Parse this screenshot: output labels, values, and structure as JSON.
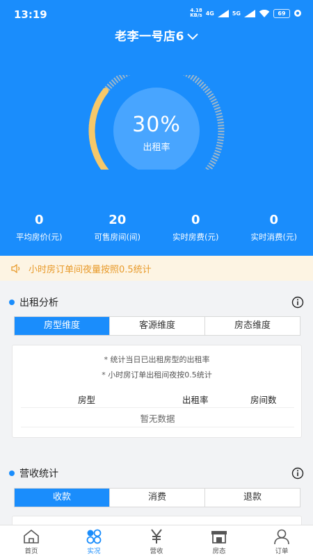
{
  "status": {
    "time": "13:19",
    "net_speed_value": "4.18",
    "net_speed_unit": "KB/s",
    "net_gen": "4G",
    "net_gen2": "5G",
    "battery": "69"
  },
  "header": {
    "store_name": "老李一号店6"
  },
  "gauge": {
    "percent": 30,
    "percent_text": "30%",
    "label": "出租率"
  },
  "stats": [
    {
      "value": "0",
      "label": "平均房价(元)"
    },
    {
      "value": "20",
      "label": "可售房间(间)"
    },
    {
      "value": "0",
      "label": "实时房费(元)"
    },
    {
      "value": "0",
      "label": "实时消费(元)"
    }
  ],
  "notice": {
    "text": "小时房订单间夜量按照0.5统计"
  },
  "rent_analysis": {
    "title": "出租分析",
    "tabs": [
      "房型维度",
      "客源维度",
      "房态维度"
    ],
    "active_tab": 0,
    "notes": [
      "* 统计当日已出租房型的出租率",
      "* 小时房订单出租间夜按0.5统计"
    ],
    "columns": [
      "房型",
      "出租率",
      "房间数"
    ],
    "empty_text": "暂无数据"
  },
  "revenue": {
    "title": "营收统计",
    "tabs": [
      "收款",
      "消费",
      "退款"
    ],
    "active_tab": 0
  },
  "nav": [
    {
      "label": "首页",
      "icon": "home-icon"
    },
    {
      "label": "实况",
      "icon": "live-icon"
    },
    {
      "label": "营收",
      "icon": "yen-icon"
    },
    {
      "label": "房态",
      "icon": "shop-icon"
    },
    {
      "label": "订单",
      "icon": "user-icon"
    }
  ],
  "colors": {
    "primary": "#1a8dfc",
    "gauge_fill": "#f6c869",
    "notice_text": "#e89a2a",
    "notice_bg": "#fdf4e3"
  }
}
